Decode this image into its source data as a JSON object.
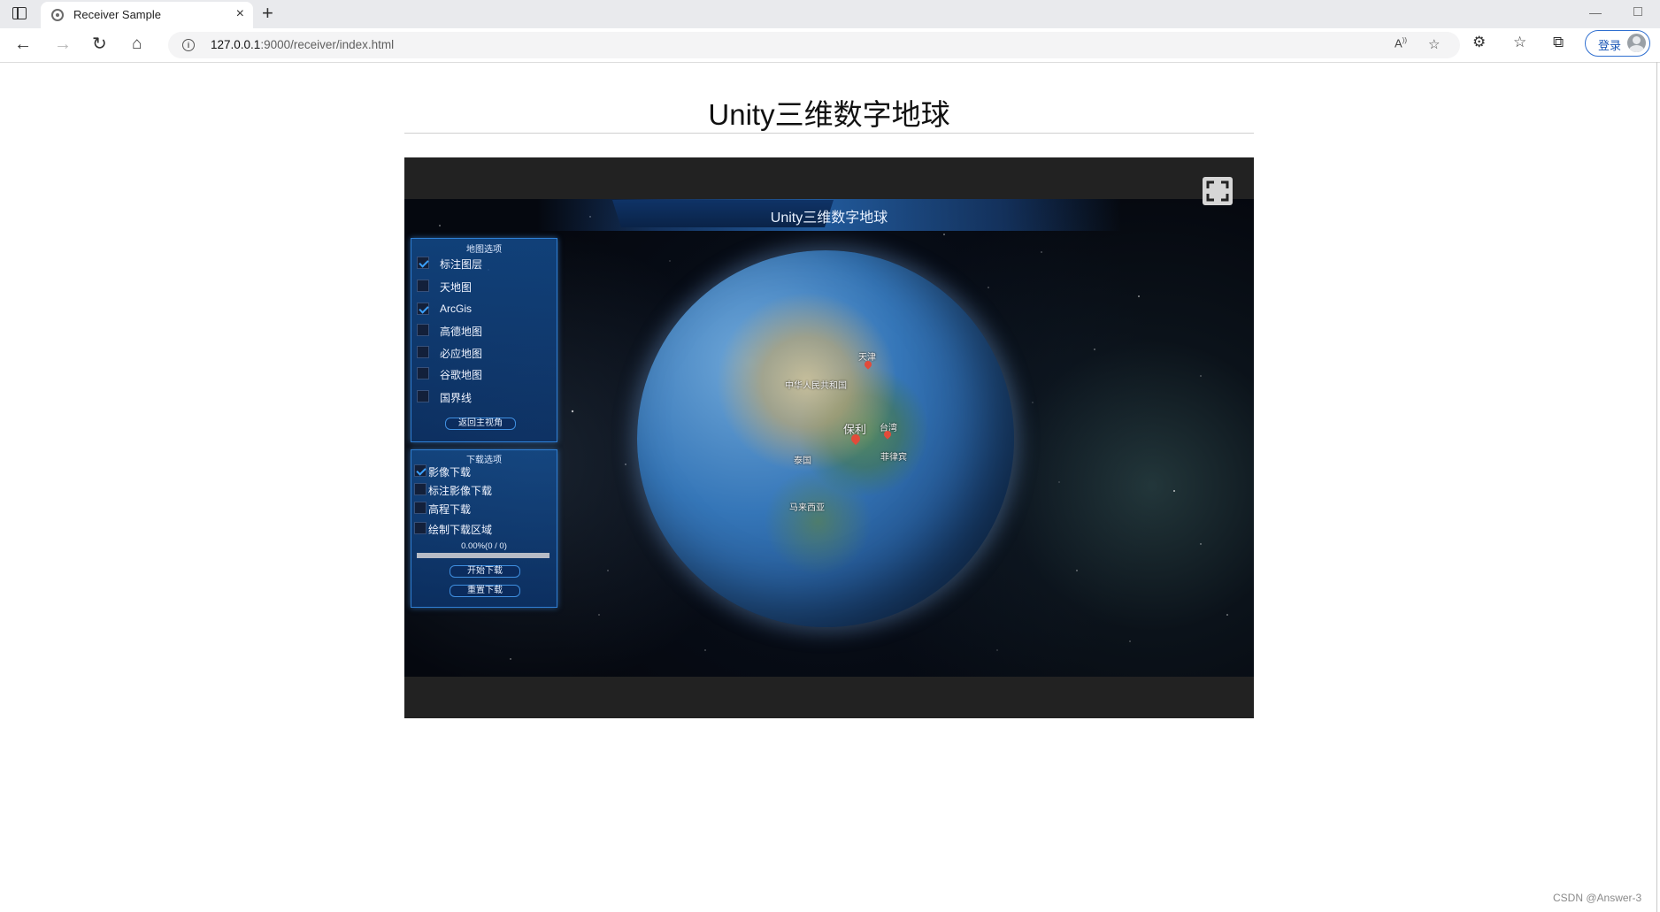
{
  "browser": {
    "tab_title": "Receiver Sample",
    "tab_close": "×",
    "new_tab": "+",
    "url_host": "127.0.0.1",
    "url_path": ":9000/receiver/index.html",
    "login_label": "登录"
  },
  "page": {
    "title": "Unity三维数字地球"
  },
  "unity": {
    "header_title": "Unity三维数字地球",
    "map_panel": {
      "title": "地图选项",
      "options": [
        {
          "label": "标注图层",
          "checked": true
        },
        {
          "label": "天地图",
          "checked": false
        },
        {
          "label": "ArcGis",
          "checked": true
        },
        {
          "label": "高德地图",
          "checked": false
        },
        {
          "label": "必应地图",
          "checked": false
        },
        {
          "label": "谷歌地图",
          "checked": false
        },
        {
          "label": "国界线",
          "checked": false
        }
      ],
      "home_button": "返回主视角"
    },
    "download_panel": {
      "title": "下载选项",
      "options": [
        {
          "label": "影像下载",
          "checked": true
        },
        {
          "label": "标注影像下载",
          "checked": false
        },
        {
          "label": "高程下载",
          "checked": false
        },
        {
          "label": "绘制下载区域",
          "checked": false
        }
      ],
      "progress_text": "0.00%(0 / 0)",
      "progress_fraction": 0.0,
      "start_button": "开始下载",
      "reset_button": "重置下载"
    },
    "globe_labels": {
      "baoli": "保利",
      "taiwan": "台湾",
      "tianjin": "天津",
      "china": "中华人民共和国",
      "thailand": "泰国",
      "malaysia": "马来西亚",
      "philippines": "菲律宾"
    }
  },
  "watermark": "CSDN @Answer-3"
}
